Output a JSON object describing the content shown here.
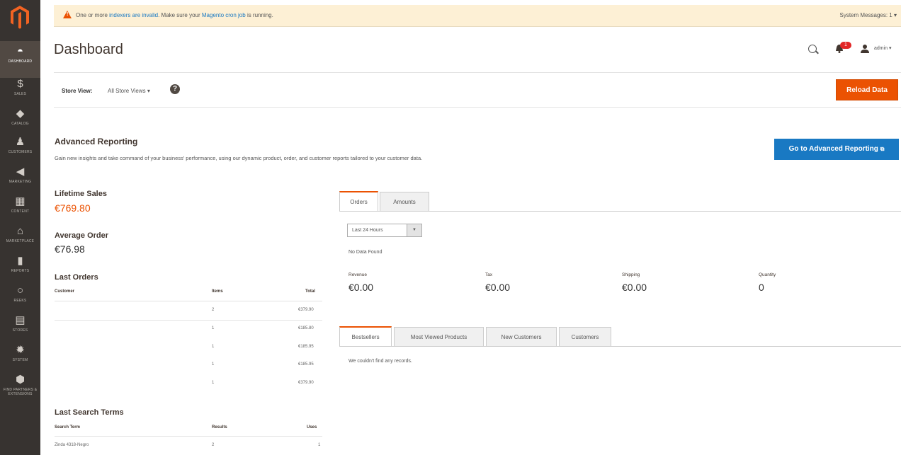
{
  "sidebar": {
    "logo": "magento-logo",
    "items": [
      {
        "label": "Dashboard",
        "icon": "dashboard-icon"
      },
      {
        "label": "Sales",
        "icon": "dollar-icon"
      },
      {
        "label": "Catalog",
        "icon": "cube-icon"
      },
      {
        "label": "Customers",
        "icon": "person-icon"
      },
      {
        "label": "Marketing",
        "icon": "megaphone-icon"
      },
      {
        "label": "Content",
        "icon": "layout-icon"
      },
      {
        "label": "Marketplace",
        "icon": "storefront-icon"
      },
      {
        "label": "Reports",
        "icon": "bar-chart-icon"
      },
      {
        "label": "Reeks",
        "icon": "circle-icon"
      },
      {
        "label": "Stores",
        "icon": "store-icon"
      },
      {
        "label": "System",
        "icon": "gear-icon"
      },
      {
        "label": "Find Partners & Extensions",
        "icon": "hexagon-icon"
      }
    ]
  },
  "system_message": {
    "text_1": "One or more ",
    "link_1": "indexers are invalid",
    "text_2": ". Make sure your ",
    "link_2": "Magento cron job",
    "text_3": " is running.",
    "messages_label": "System Messages: 1"
  },
  "header": {
    "title": "Dashboard",
    "notification_count": "1",
    "user": "admin"
  },
  "store_view": {
    "label": "Store View:",
    "value": "All Store Views",
    "reload_button": "Reload Data"
  },
  "advanced_reporting": {
    "title": "Advanced Reporting",
    "description": "Gain new insights and take command of your business' performance, using our dynamic product, order, and customer reports tailored to your customer data.",
    "button": "Go to Advanced Reporting"
  },
  "stats": {
    "lifetime_sales_label": "Lifetime Sales",
    "lifetime_sales_value": "€769.80",
    "average_order_label": "Average Order",
    "average_order_value": "€76.98"
  },
  "last_orders": {
    "title": "Last Orders",
    "headers": [
      "Customer",
      "Items",
      "Total"
    ],
    "rows": [
      {
        "customer": "",
        "items": "2",
        "total": "€379.90"
      },
      {
        "customer": "",
        "items": "1",
        "total": "€185.80"
      },
      {
        "customer": "",
        "items": "1",
        "total": "€185.95"
      },
      {
        "customer": "",
        "items": "1",
        "total": "€185.95"
      },
      {
        "customer": "",
        "items": "1",
        "total": "€379.90"
      }
    ]
  },
  "last_search_terms": {
    "title": "Last Search Terms",
    "headers": [
      "Search Term",
      "Results",
      "Uses"
    ],
    "rows": [
      {
        "term": "Zinda 4318-Negro",
        "results": "2",
        "uses": "1"
      }
    ]
  },
  "chart_tabs": {
    "tabs": [
      "Orders",
      "Amounts"
    ],
    "period": "Last 24 Hours",
    "no_data": "No Data Found"
  },
  "totals": [
    {
      "label": "Revenue",
      "value": "€0.00"
    },
    {
      "label": "Tax",
      "value": "€0.00"
    },
    {
      "label": "Shipping",
      "value": "€0.00"
    },
    {
      "label": "Quantity",
      "value": "0"
    }
  ],
  "grid_tabs": {
    "tabs": [
      "Bestsellers",
      "Most Viewed Products",
      "New Customers",
      "Customers"
    ],
    "empty": "We couldn't find any records."
  },
  "colors": {
    "accent": "#eb5202",
    "link": "#1979c3",
    "sidebar": "#373330"
  }
}
